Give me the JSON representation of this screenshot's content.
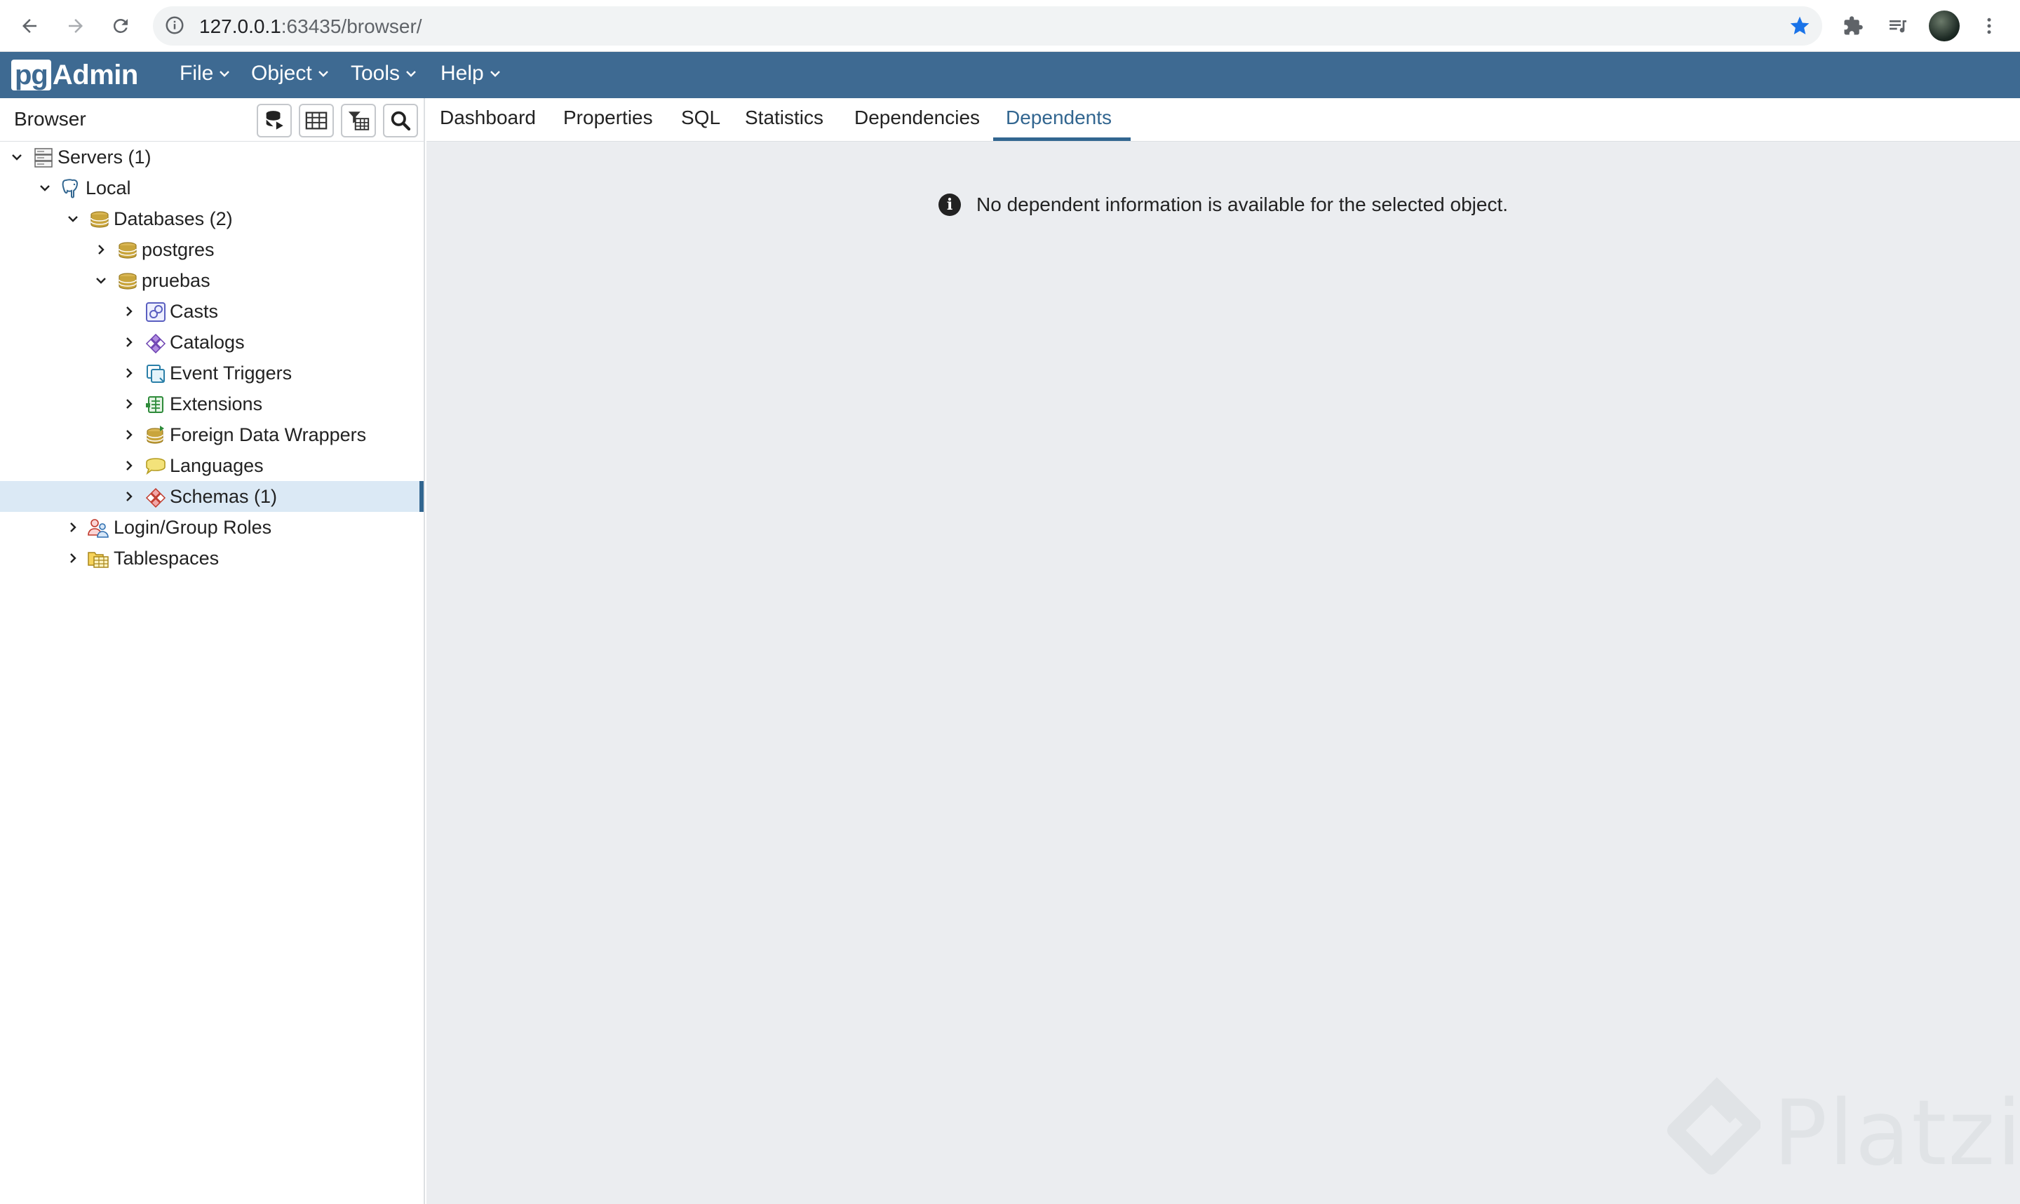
{
  "browser_bar": {
    "url_host": "127.0.0.1",
    "url_rest": ":63435/browser/"
  },
  "app": {
    "logo_pg": "pg",
    "logo_admin": "Admin",
    "menus": [
      "File",
      "Object",
      "Tools",
      "Help"
    ]
  },
  "browser_panel": {
    "title": "Browser",
    "tree": [
      {
        "label": "Servers (1)",
        "expanded": true,
        "icon": "servers-icon"
      },
      {
        "label": "Local",
        "expanded": true,
        "icon": "postgres-elephant-icon"
      },
      {
        "label": "Databases (2)",
        "expanded": true,
        "icon": "databases-icon"
      },
      {
        "label": "postgres",
        "expanded": false,
        "icon": "database-icon"
      },
      {
        "label": "pruebas",
        "expanded": true,
        "icon": "database-icon"
      },
      {
        "label": "Casts",
        "expanded": false,
        "icon": "casts-icon"
      },
      {
        "label": "Catalogs",
        "expanded": false,
        "icon": "catalogs-icon"
      },
      {
        "label": "Event Triggers",
        "expanded": false,
        "icon": "event-triggers-icon"
      },
      {
        "label": "Extensions",
        "expanded": false,
        "icon": "extensions-icon"
      },
      {
        "label": "Foreign Data Wrappers",
        "expanded": false,
        "icon": "foreign-data-wrappers-icon"
      },
      {
        "label": "Languages",
        "expanded": false,
        "icon": "languages-icon"
      },
      {
        "label": "Schemas (1)",
        "expanded": false,
        "icon": "schemas-icon",
        "selected": true
      },
      {
        "label": "Login/Group Roles",
        "expanded": false,
        "icon": "roles-icon"
      },
      {
        "label": "Tablespaces",
        "expanded": false,
        "icon": "tablespaces-icon"
      }
    ]
  },
  "tabs": [
    "Dashboard",
    "Properties",
    "SQL",
    "Statistics",
    "Dependencies",
    "Dependents"
  ],
  "active_tab": "Dependents",
  "message": "No dependent information is available for the selected object.",
  "watermark": "Platzi",
  "colors": {
    "header": "#3e6a92",
    "accent": "#326690",
    "selection": "#dbe9f5",
    "content_bg": "#ebedf0"
  }
}
